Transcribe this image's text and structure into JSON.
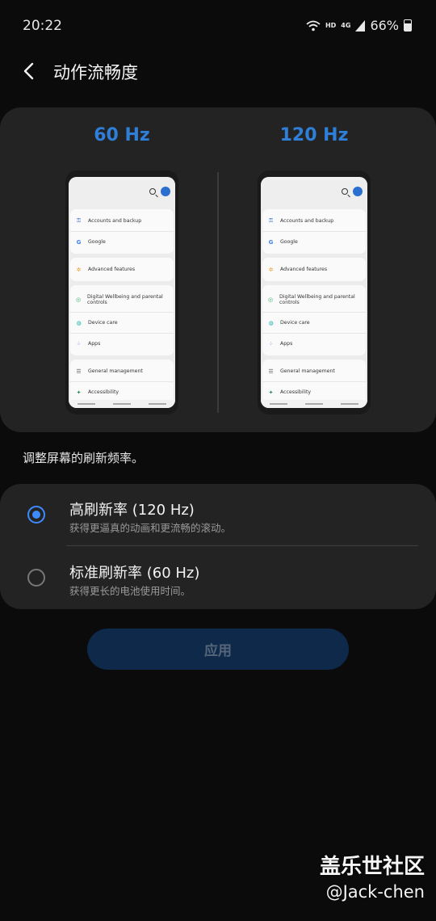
{
  "status_bar": {
    "time": "20:22",
    "network": "HD",
    "signal": "4G",
    "battery": "66%"
  },
  "header": {
    "title": "动作流畅度"
  },
  "preview": {
    "left_label": "60 Hz",
    "right_label": "120 Hz",
    "menu_groups": [
      [
        "Accounts and backup",
        "Google"
      ],
      [
        "Advanced features"
      ],
      [
        "Digital Wellbeing and parental controls",
        "Device care",
        "Apps"
      ],
      [
        "General management",
        "Accessibility"
      ]
    ]
  },
  "description": "调整屏幕的刷新频率。",
  "options": [
    {
      "title": "高刷新率 (120 Hz)",
      "subtitle": "获得更逼真的动画和更流畅的滚动。",
      "selected": true
    },
    {
      "title": "标准刷新率 (60 Hz)",
      "subtitle": "获得更长的电池使用时间。",
      "selected": false
    }
  ],
  "apply_label": "应用",
  "watermark": {
    "line1": "盖乐世社区",
    "line2": "@Jack-chen"
  },
  "colors": {
    "accent": "#2f7ed8",
    "radio": "#3d8bfd",
    "card": "#232323",
    "background": "#0b0b0b"
  }
}
